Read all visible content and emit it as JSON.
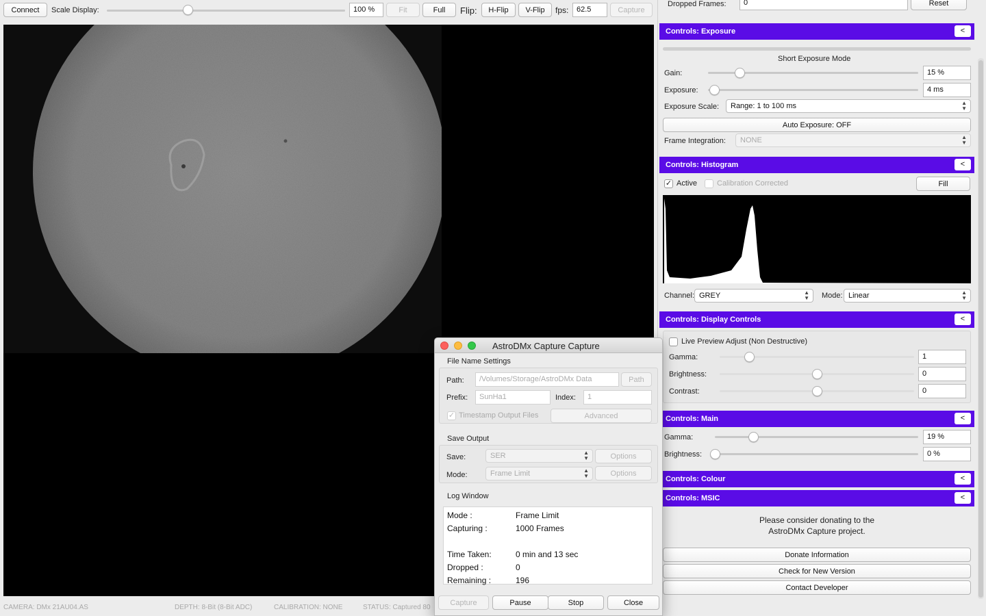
{
  "toolbar": {
    "connect": "Connect",
    "scale_display_label": "Scale Display:",
    "scale_value": "100 %",
    "scale_fraction": 0.34,
    "fit": "Fit",
    "full": "Full",
    "flip_label": "Flip:",
    "hflip": "H-Flip",
    "vflip": "V-Flip",
    "fps_label": "fps:",
    "fps_value": "62.5",
    "capture": "Capture"
  },
  "status_bar": {
    "camera": "CAMERA: DMx 21AU04.AS",
    "depth": "DEPTH: 8-Bit (8-Bit ADC)",
    "calibration": "CALIBRATION: NONE",
    "status": "STATUS: Captured 80"
  },
  "right_panel": {
    "dropped_frames_label": "Dropped Frames:",
    "dropped_frames_value": "0",
    "reset": "Reset",
    "exposure": {
      "title": "Controls: Exposure",
      "collapse": "<",
      "mode": "Short Exposure Mode",
      "gain_label": "Gain:",
      "gain_value": "15 %",
      "gain_fraction": 0.15,
      "exposure_label": "Exposure:",
      "exposure_value": "4 ms",
      "exposure_fraction": 0.03,
      "scale_label": "Exposure Scale:",
      "scale_value": "Range: 1 to 100 ms",
      "auto_exposure": "Auto Exposure: OFF",
      "integration_label": "Frame Integration:",
      "integration_value": "NONE"
    },
    "histogram": {
      "title": "Controls: Histogram",
      "collapse": "<",
      "active_label": "Active",
      "calibration_label": "Calibration Corrected",
      "fill": "Fill",
      "channel_label": "Channel:",
      "channel_value": "GREY",
      "mode_label": "Mode:",
      "mode_value": "Linear"
    },
    "display": {
      "title": "Controls: Display Controls",
      "collapse": "<",
      "live_preview": "Live Preview Adjust (Non Destructive)",
      "gamma_label": "Gamma:",
      "gamma_value": "1",
      "gamma_fraction": 0.15,
      "brightness_label": "Brightness:",
      "brightness_value": "0",
      "brightness_fraction": 0.5,
      "contrast_label": "Contrast:",
      "contrast_value": "0",
      "contrast_fraction": 0.5
    },
    "main": {
      "title": "Controls: Main",
      "collapse": "<",
      "gamma_label": "Gamma:",
      "gamma_value": "19 %",
      "gamma_fraction": 0.19,
      "brightness_label": "Brightness:",
      "brightness_value": "0 %",
      "brightness_fraction": 0.0
    },
    "colour": {
      "title": "Controls: Colour",
      "collapse": "<"
    },
    "msic": {
      "title": "Controls: MSIC",
      "collapse": "<",
      "donate_line1": "Please consider donating to the",
      "donate_line2": "AstroDMx Capture project.",
      "donate_info": "Donate Information",
      "check_version": "Check for New Version",
      "contact": "Contact Developer"
    }
  },
  "dialog": {
    "title": "AstroDMx Capture Capture",
    "file_settings": "File Name Settings",
    "path_label": "Path:",
    "path_value": "/Volumes/Storage/AstroDMx Data",
    "path_button": "Path",
    "prefix_label": "Prefix:",
    "prefix_value": "SunHa1",
    "index_label": "Index:",
    "index_value": "1",
    "timestamp_label": "Timestamp Output Files",
    "advanced": "Advanced",
    "save_output": "Save Output",
    "save_label": "Save:",
    "save_value": "SER",
    "options1": "Options",
    "mode_label": "Mode:",
    "mode_value": "Frame Limit",
    "options2": "Options",
    "log_title": "Log Window",
    "log": [
      {
        "key": "Mode      :",
        "value": "Frame Limit"
      },
      {
        "key": "Capturing :",
        "value": "1000 Frames"
      },
      {
        "key": "",
        "value": ""
      },
      {
        "key": "Time Taken:",
        "value": "0 min and 13 sec"
      },
      {
        "key": "Dropped   :",
        "value": "0"
      },
      {
        "key": "Remaining :",
        "value": "196"
      }
    ],
    "capture": "Capture",
    "pause": "Pause",
    "stop": "Stop",
    "close": "Close"
  }
}
